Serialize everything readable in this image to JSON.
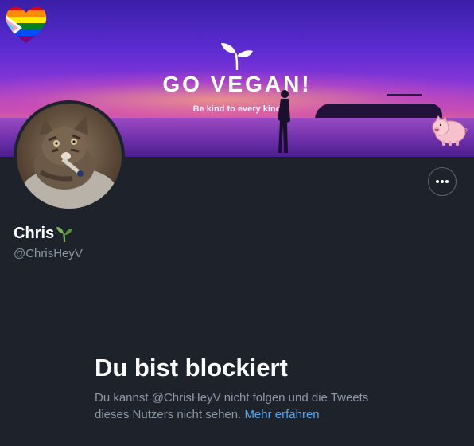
{
  "banner": {
    "headline": "GO VEGAN!",
    "tagline": "Be kind to every kind"
  },
  "profile": {
    "name": "Chris",
    "name_emoji": "seedling-icon",
    "handle": "@ChrisHeyV",
    "more_icon": "more-dots-icon"
  },
  "blocked": {
    "title": "Du bist blockiert",
    "body_part1": "Du kannst @ChrisHeyV nicht folgen und die Tweets dieses Nutzers nicht sehen.",
    "learn_more": "Mehr erfahren"
  },
  "colors": {
    "background": "#1e232b",
    "link": "#5aa7f0",
    "secondary_text": "#8b98a5"
  }
}
